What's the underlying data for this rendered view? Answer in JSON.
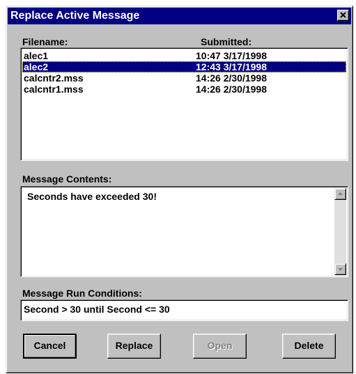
{
  "window": {
    "title": "Replace Active Message",
    "close_glyph": "✕",
    "title_bar_color": "#000080",
    "face_color": "#c0c0c0"
  },
  "file_list": {
    "header_filename": "Filename:",
    "header_submitted": "Submitted:",
    "rows": [
      {
        "filename": "alec1",
        "submitted": "10:47 3/17/1998",
        "selected": false
      },
      {
        "filename": "alec2",
        "submitted": "12:43 3/17/1998",
        "selected": true
      },
      {
        "filename": "calcntr2.mss",
        "submitted": "14:26 2/30/1998",
        "selected": false
      },
      {
        "filename": "calcntr1.mss",
        "submitted": "14:26 2/30/1998",
        "selected": false
      }
    ]
  },
  "message_contents": {
    "label": "Message Contents:",
    "text": "Seconds have exceeded 30!",
    "scroll_up_icon": "arrow-up-icon",
    "scroll_down_icon": "arrow-down-icon"
  },
  "run_conditions": {
    "label": "Message Run Conditions:",
    "value": "Second > 30 until Second <= 30"
  },
  "buttons": {
    "cancel": "Cancel",
    "replace": "Replace",
    "open": "Open",
    "delete": "Delete",
    "open_disabled": true
  }
}
